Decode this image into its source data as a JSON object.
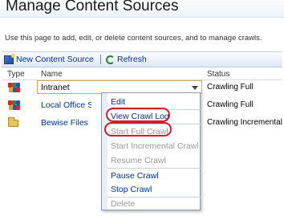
{
  "page": {
    "title": "Manage Content Sources",
    "description": "Use this page to add, edit, or delete content sources, and to manage crawls."
  },
  "toolbar": {
    "new_label": "New Content Source",
    "refresh_label": "Refresh"
  },
  "table": {
    "columns": {
      "type": "Type",
      "name": "Name",
      "status": "Status"
    },
    "rows": [
      {
        "name": "Intranet",
        "status": "Crawling Full",
        "icon": "sharepoint-sites-icon"
      },
      {
        "name": "Local Office Sha",
        "status": "Crawling Full",
        "icon": "sharepoint-sites-icon"
      },
      {
        "name": "Bewise Files",
        "status": "Crawling Incremental",
        "icon": "file-share-folder-icon"
      }
    ]
  },
  "context_menu": {
    "items": [
      {
        "label": "Edit",
        "enabled": true
      },
      {
        "label": "View Crawl Log",
        "enabled": true
      },
      {
        "label": "Start Full Crawl",
        "enabled": false
      },
      {
        "label": "Start Incremental Crawl",
        "enabled": false
      },
      {
        "label": "Resume Crawl",
        "enabled": false
      },
      {
        "label": "Pause Crawl",
        "enabled": true
      },
      {
        "label": "Stop Crawl",
        "enabled": true
      },
      {
        "label": "Delete",
        "enabled": false
      }
    ]
  },
  "colors": {
    "link": "#003399",
    "disabled": "#999999",
    "highlight": "#d11f2a"
  }
}
